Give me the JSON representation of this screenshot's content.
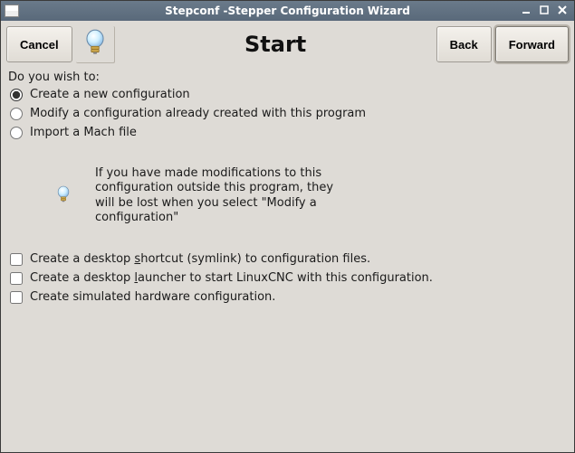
{
  "titlebar": {
    "title": "Stepconf -Stepper Configuration Wizard"
  },
  "header": {
    "cancel_label": "Cancel",
    "start_label": "Start",
    "back_label": "Back",
    "forward_label": "Forward"
  },
  "prompt": "Do you wish to:",
  "options": {
    "create": "Create a new configuration",
    "modify": "Modify a configuration already created with this program",
    "mach": "Import a Mach file"
  },
  "warning": "If you have made modifications to this configuration outside this program, they will be lost when you select \"Modify a configuration\"",
  "checks": {
    "shortcut_pre": "Create a desktop ",
    "shortcut_mn": "s",
    "shortcut_post": "hortcut (symlink) to configuration files.",
    "launcher_pre": "Create a desktop ",
    "launcher_mn": "l",
    "launcher_post": "auncher to start LinuxCNC with this configuration.",
    "sim": "Create simulated hardware configuration."
  }
}
